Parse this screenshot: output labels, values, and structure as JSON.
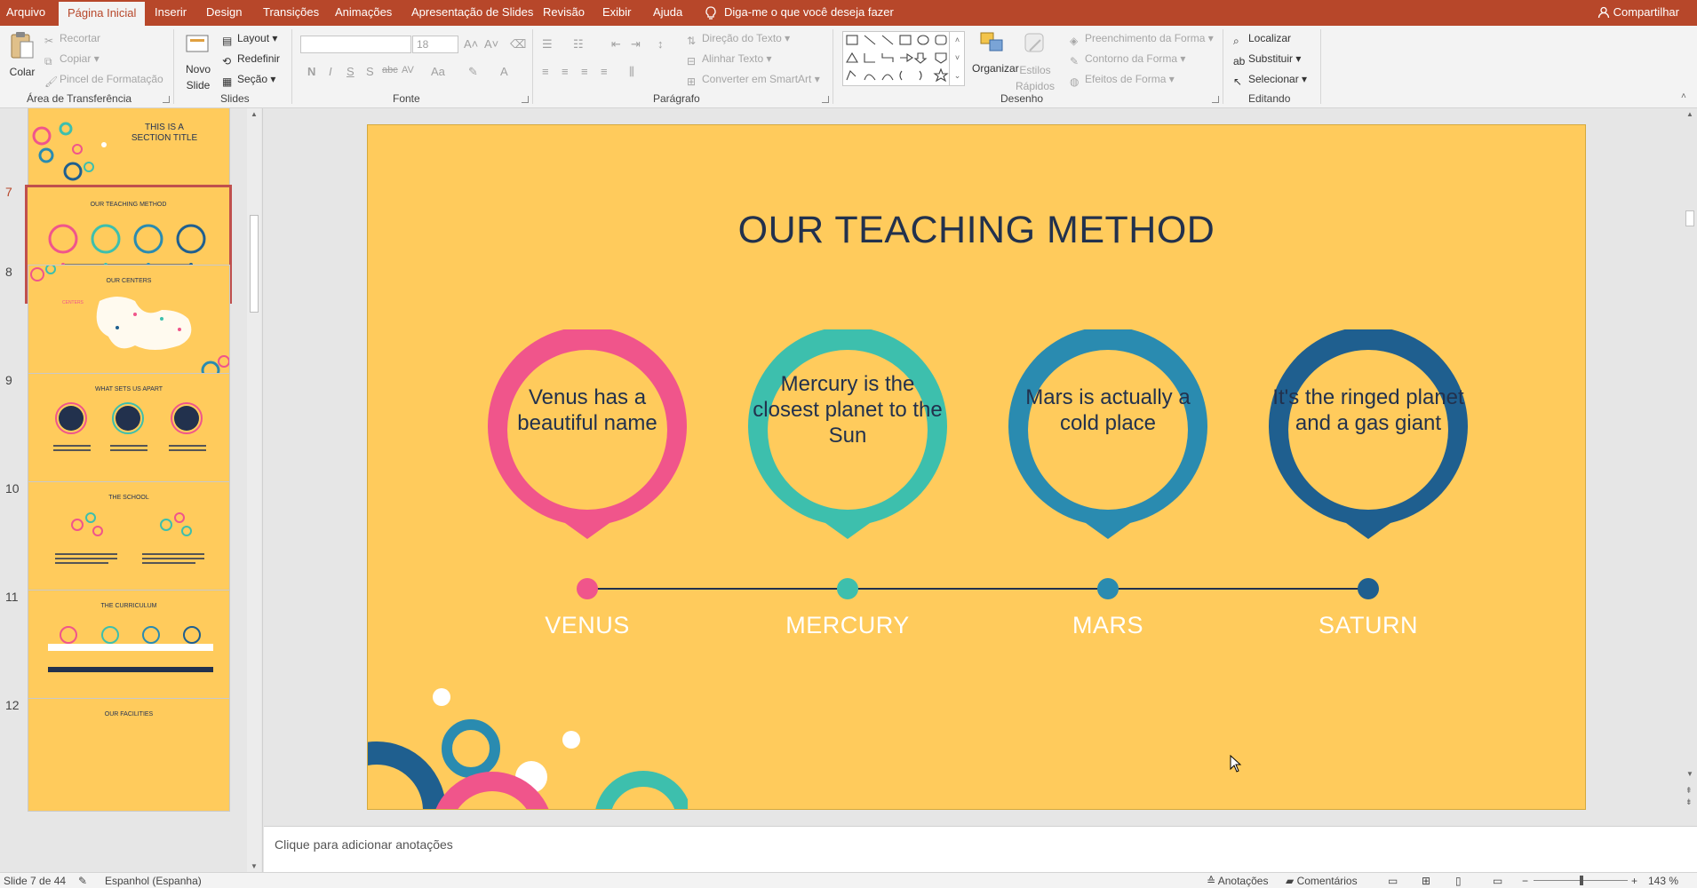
{
  "tabs": [
    {
      "label": "Arquivo",
      "active": false
    },
    {
      "label": "Página Inicial",
      "active": true
    },
    {
      "label": "Inserir",
      "active": false
    },
    {
      "label": "Design",
      "active": false
    },
    {
      "label": "Transições",
      "active": false
    },
    {
      "label": "Animações",
      "active": false
    },
    {
      "label": "Apresentação de Slides",
      "active": false
    },
    {
      "label": "Revisão",
      "active": false
    },
    {
      "label": "Exibir",
      "active": false
    },
    {
      "label": "Ajuda",
      "active": false
    }
  ],
  "tell_me": "Diga-me o que você deseja fazer",
  "share": "Compartilhar",
  "ribbon": {
    "clipboard": {
      "paste": "Colar",
      "cut": "Recortar",
      "copy": "Copiar",
      "format_painter": "Pincel de Formatação",
      "label": "Área de Transferência"
    },
    "slides": {
      "new_slide_1": "Novo",
      "new_slide_2": "Slide",
      "layout": "Layout",
      "reset": "Redefinir",
      "section": "Seção",
      "label": "Slides"
    },
    "font": {
      "size": "18",
      "label": "Fonte",
      "bold": "N",
      "italic": "I",
      "underline": "S",
      "shadow": "S",
      "strike": "abc",
      "spacing": "AV",
      "case": "Aa",
      "color": "A"
    },
    "paragraph": {
      "text_direction": "Direção do Texto",
      "align_text": "Alinhar Texto",
      "smartart": "Converter em SmartArt",
      "label": "Parágrafo"
    },
    "drawing": {
      "arrange": "Organizar",
      "quick_styles_1": "Estilos",
      "quick_styles_2": "Rápidos",
      "shape_fill": "Preenchimento da Forma",
      "shape_outline": "Contorno da Forma",
      "shape_effects": "Efeitos de Forma",
      "label": "Desenho"
    },
    "editing": {
      "find": "Localizar",
      "replace": "Substituir",
      "select": "Selecionar",
      "label": "Editando"
    }
  },
  "thumbnails": [
    {
      "num": "",
      "title": "THIS IS A SECTION TITLE"
    },
    {
      "num": "7",
      "title": "OUR TEACHING METHOD",
      "selected": true
    },
    {
      "num": "8",
      "title": "OUR CENTERS",
      "sub": "CENTERS"
    },
    {
      "num": "9",
      "title": "WHAT SETS US APART"
    },
    {
      "num": "10",
      "title": "THE SCHOOL"
    },
    {
      "num": "11",
      "title": "THE CURRICULUM"
    },
    {
      "num": "12",
      "title": "OUR FACILITIES"
    }
  ],
  "slide": {
    "title": "OUR TEACHING METHOD",
    "items": [
      {
        "text": "Venus has a beautiful name",
        "planet": "VENUS",
        "color": "#f0558b"
      },
      {
        "text": "Mercury is the closest planet to the Sun",
        "planet": "MERCURY",
        "color": "#3dbfad"
      },
      {
        "text": "Mars is actually a cold place",
        "planet": "MARS",
        "color": "#2a8bb0"
      },
      {
        "text": "It's the ringed planet and a gas giant",
        "planet": "SATURN",
        "color": "#1f5f8f"
      }
    ]
  },
  "notes_placeholder": "Clique para adicionar anotações",
  "status": {
    "slide_counter": "Slide 7 de 44",
    "language": "Espanhol (Espanha)",
    "notes": "Anotações",
    "comments": "Comentários",
    "zoom": "143 %"
  },
  "colors": {
    "ribbon_accent": "#b7472a",
    "slide_bg": "#ffcb5c",
    "title": "#22314d"
  }
}
